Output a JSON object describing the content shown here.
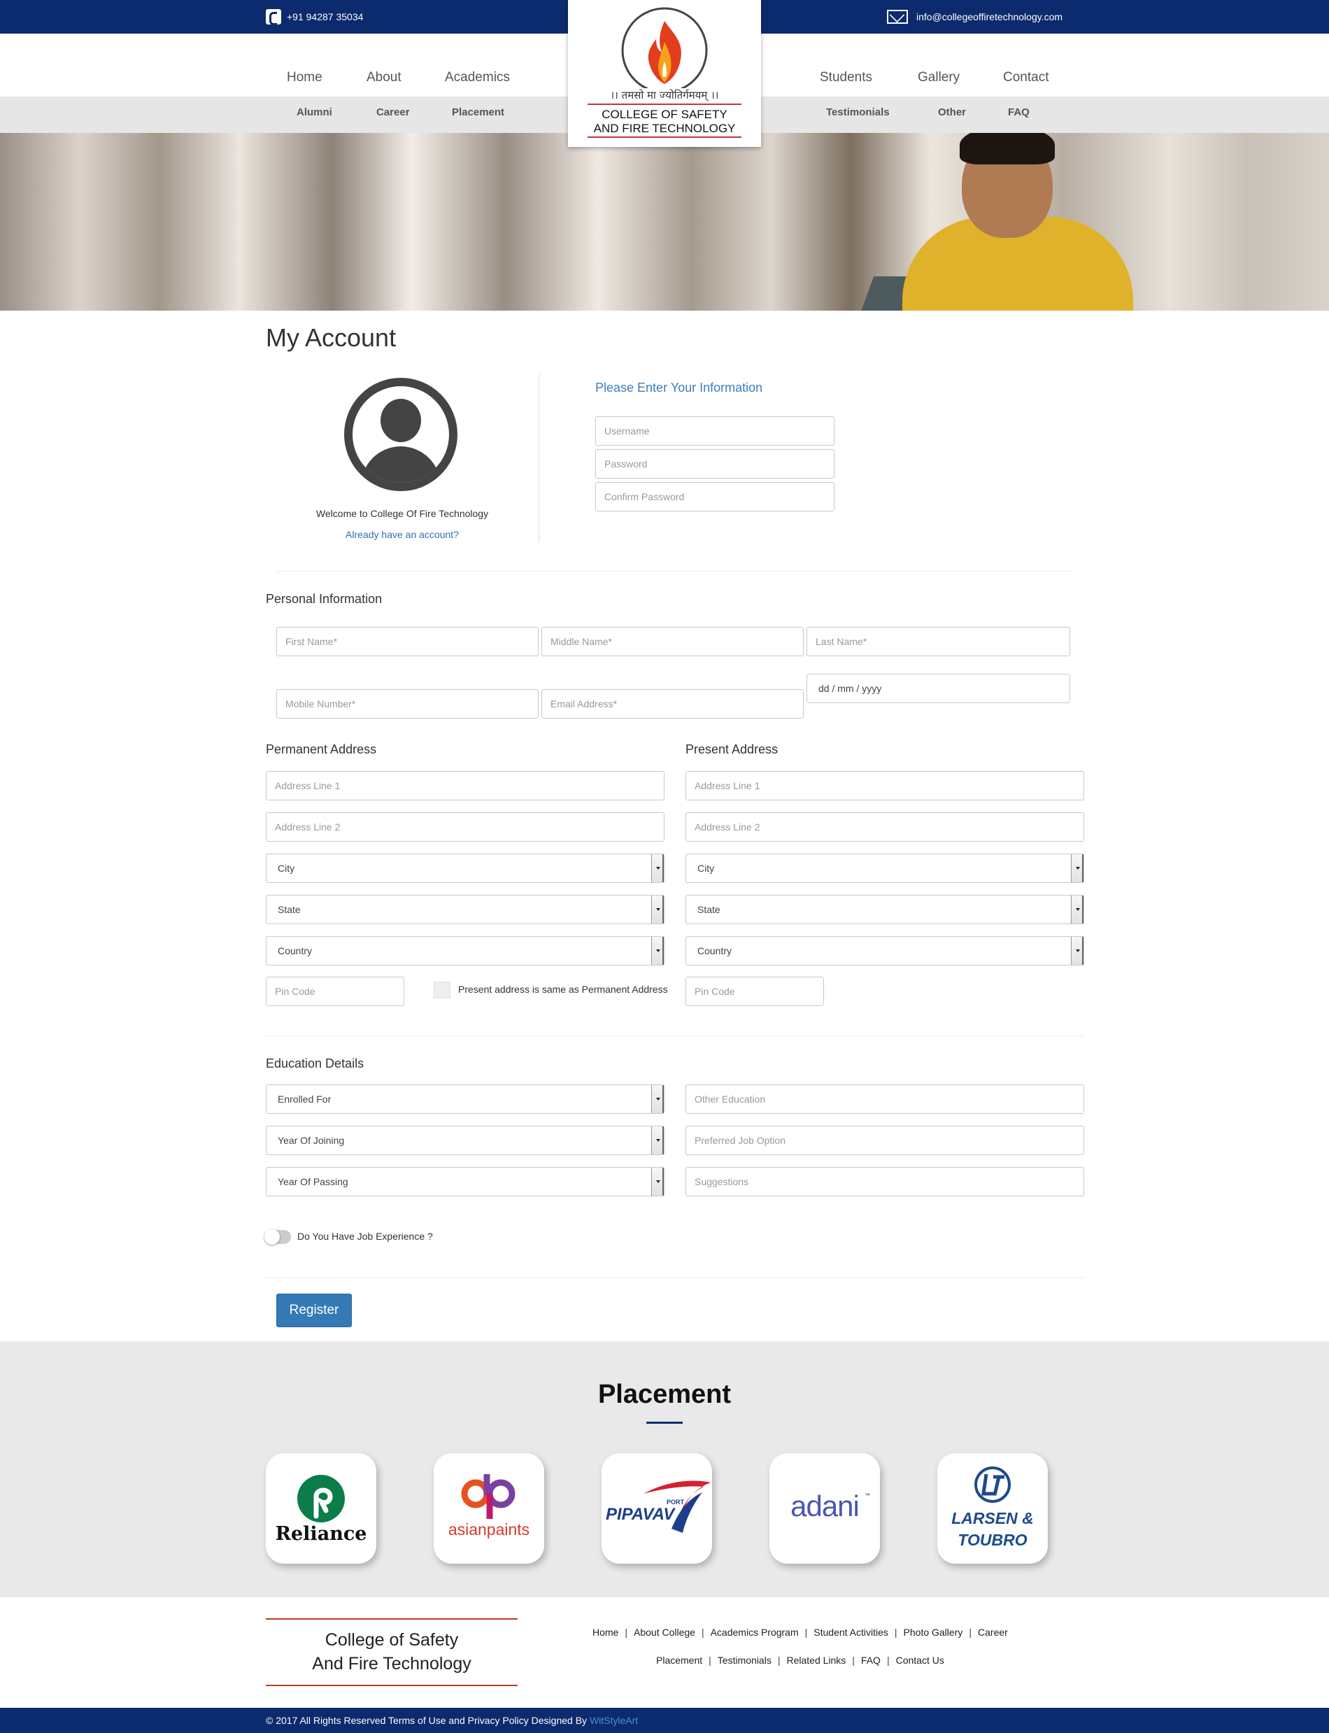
{
  "topbar": {
    "phone": "+91 94287 35034",
    "email": "info@collegeoffiretechnology.com",
    "phone_icon": "phone-icon",
    "email_icon": "envelope-icon"
  },
  "nav": {
    "left": [
      "Home",
      "About",
      "Academics"
    ],
    "right": [
      "Students",
      "Gallery",
      "Contact"
    ],
    "sub_left": [
      "Alumni",
      "Career",
      "Placement"
    ],
    "sub_right": [
      "Testimonials",
      "Other",
      "FAQ"
    ]
  },
  "logo": {
    "motto": "।। तमसो मा ज्योतिर्गमयम् ।।",
    "line1": "COLLEGE OF SAFETY",
    "line2": "AND FIRE TECHNOLOGY"
  },
  "page": {
    "title": "My Account"
  },
  "account": {
    "welcome": "Welcome to College Of Fire Technology",
    "already": "Already have an account?",
    "heading": "Please Enter Your Information",
    "username_placeholder": "Username",
    "password_placeholder": "Password",
    "confirm_placeholder": "Confirm Password"
  },
  "personal": {
    "title": "Personal Information",
    "first_name": "First Name*",
    "middle_name": "Middle Name*",
    "last_name": "Last Name*",
    "mobile": "Mobile Number*",
    "email": "Email Address*",
    "dob": "dd / mm / yyyy"
  },
  "permanent": {
    "title": "Permanent Address",
    "address1": "Address Line 1",
    "address2": "Address Line 2",
    "city": "City",
    "state": "State",
    "country": "Country",
    "pin": "Pin Code",
    "same_label": "Present address is same as Permanent Address"
  },
  "present": {
    "title": "Present Address",
    "address1": "Address Line 1",
    "address2": "Address Line 2",
    "city": "City",
    "state": "State",
    "country": "Country",
    "pin": "Pin Code"
  },
  "education": {
    "title": "Education Details",
    "enrolled": "Enrolled For",
    "joining": "Year Of Joining",
    "passing": "Year Of Passing",
    "other": "Other Education",
    "job_option": "Preferred Job Option",
    "suggestions": "Suggestions",
    "job_experience": "Do You Have Job Experience ?",
    "register": "Register"
  },
  "placement": {
    "title": "Placement",
    "logos": [
      "Reliance",
      "asianpaints",
      "PIPAVAV",
      "adani",
      "LARSEN & TOUBRO"
    ],
    "pipavav_sup": "PORT",
    "lt_line1": "LARSEN &",
    "lt_line2": "TOUBRO",
    "adani_tm": "™"
  },
  "footer": {
    "title1": "College of Safety",
    "title2": "And Fire Technology",
    "links1": [
      "Home",
      "About College",
      "Academics Program",
      "Student Activities",
      "Photo Gallery",
      "Career"
    ],
    "links2": [
      "Placement",
      "Testimonials",
      "Related Links",
      "FAQ",
      "Contact Us"
    ],
    "copyright": "© 2017 All Rights Reserved Terms of Use and Privacy Policy Designed By",
    "designer": "WitStyleArt"
  },
  "colors": {
    "navy": "#0c2a6e",
    "accent_blue": "#337ab7",
    "logo_red": "#c0392b"
  }
}
